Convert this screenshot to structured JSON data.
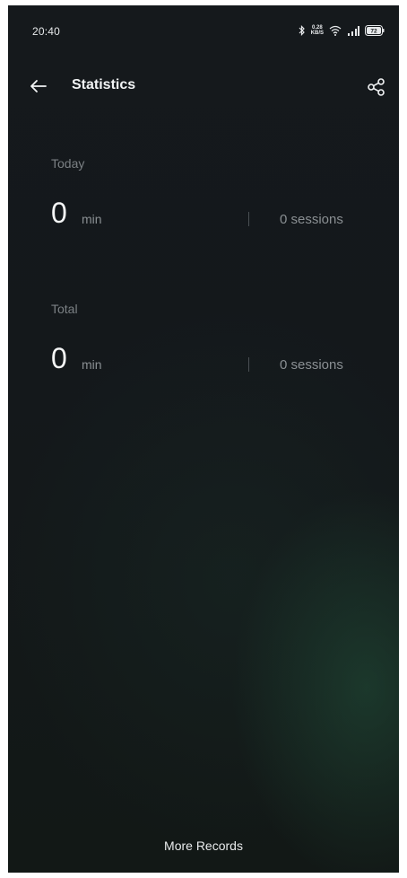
{
  "status_bar": {
    "time": "20:40",
    "net_speed_value": "0.28",
    "net_speed_unit": "KB/S",
    "battery_level": "72",
    "icons": [
      "bluetooth-icon",
      "wifi-icon",
      "signal-icon",
      "battery-icon"
    ]
  },
  "app_bar": {
    "title": "Statistics",
    "back_icon": "arrow-left-icon",
    "share_icon": "share-icon"
  },
  "today": {
    "label": "Today",
    "value": "0",
    "unit": "min",
    "sessions": "0 sessions"
  },
  "total": {
    "label": "Total",
    "value": "0",
    "unit": "min",
    "sessions": "0 sessions"
  },
  "footer": {
    "more_records_label": "More Records"
  },
  "colors": {
    "background": "#14181b",
    "accent_glow": "#22503a",
    "text_primary": "#f5f6f7",
    "text_secondary": "#8a8f93"
  }
}
